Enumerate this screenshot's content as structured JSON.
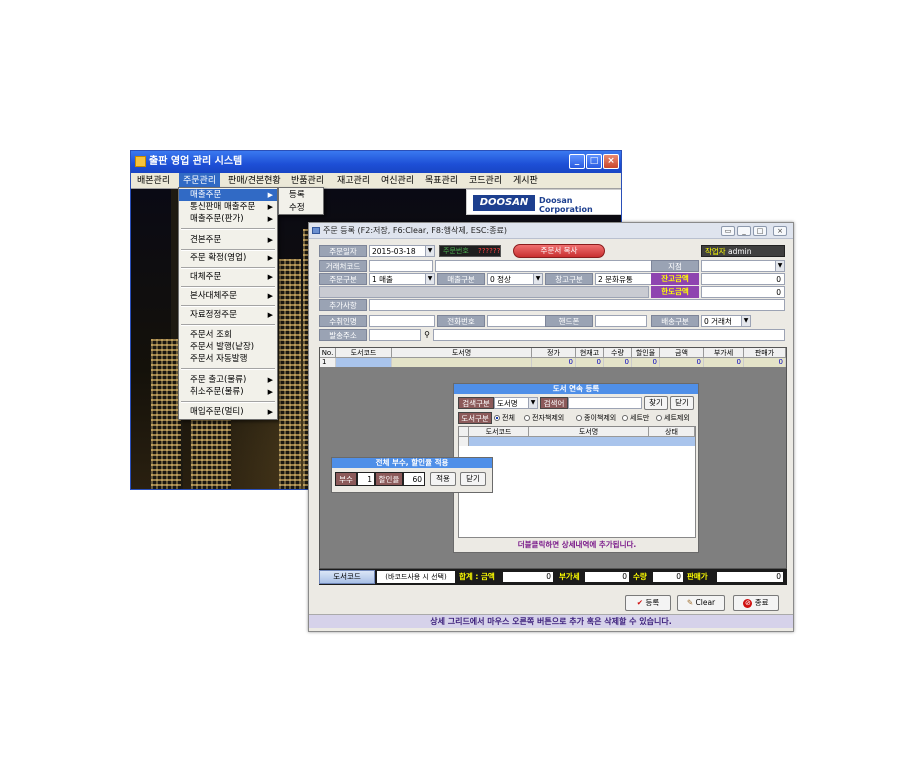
{
  "back_window": {
    "title": "출판 영업 관리 시스템",
    "menubar": [
      "배본관리",
      "주문관리",
      "판매/견본현황",
      "반품관리",
      "재고관리",
      "여신관리",
      "목표관리",
      "코드관리",
      "게시판"
    ],
    "dropdown": [
      {
        "label": "매출주문",
        "arrow": "▶"
      },
      {
        "label": "통신판매 매출주문",
        "arrow": "▶"
      },
      {
        "label": "매출주문(판가)",
        "arrow": "▶"
      },
      {
        "label": "견본주문",
        "arrow": "▶"
      },
      {
        "label": "주문 확정(영업)",
        "arrow": "▶"
      },
      {
        "label": "대체주문",
        "arrow": "▶"
      },
      {
        "label": "본사대체주문",
        "arrow": "▶"
      },
      {
        "label": "자료정정주문",
        "arrow": "▶"
      },
      {
        "label": "주문서 조회",
        "arrow": ""
      },
      {
        "label": "주문서 발행(낱장)",
        "arrow": ""
      },
      {
        "label": "주문서 자동발행",
        "arrow": ""
      },
      {
        "label": "주문 출고(물류)",
        "arrow": "▶"
      },
      {
        "label": "취소주문(물류)",
        "arrow": "▶"
      },
      {
        "label": "매입주문(멀티)",
        "arrow": "▶"
      }
    ],
    "submenu": [
      "등록",
      "수정"
    ],
    "logo_text": "DOOSAN",
    "logo_corp": "Doosan Corporation"
  },
  "front_window": {
    "title": "주문 등록 (F2:저장, F6:Clear, F8:행삭제, ESC:종료)",
    "form": {
      "order_date_label": "주문일자",
      "order_date": "2015-03-18",
      "order_no_label": "주문번호",
      "order_no": "??????",
      "copy_button": "주문서 복사",
      "worker_label": "작업자",
      "worker": "admin",
      "customer_code_label": "거래처코드",
      "branch_label": "지점",
      "order_type_label": "주문구분",
      "order_type": "1 매출",
      "sales_type_label": "매출구분",
      "sales_type": "0 정상",
      "warehouse_type_label": "창고구분",
      "warehouse_type": "2 문화유통",
      "balance_label": "잔고금액",
      "balance": "0",
      "limit_label": "한도금액",
      "limit": "0",
      "note_label": "추가사항",
      "recipient_label": "수취인명",
      "phone_label": "전화번호",
      "mobile_label": "핸드폰",
      "delivery_type_label": "배송구분",
      "delivery_type": "0 거래처",
      "ship_addr_label": "발송주소"
    },
    "grid": {
      "headers": [
        "No.",
        "도서코드",
        "도서명",
        "정가",
        "현재고",
        "수량",
        "할인율",
        "금액",
        "부가세",
        "판매가"
      ],
      "rows": [
        [
          "1",
          "",
          "",
          "0",
          "0",
          "0",
          "0",
          "0",
          "0",
          "0"
        ]
      ]
    },
    "book_dialog": {
      "title": "도서 연속 등록",
      "search_type_label": "검색구분",
      "search_type": "도서명",
      "search_word_label": "검색어",
      "find_button": "찾기",
      "close_button": "닫기",
      "book_type_label": "도서구분",
      "radios": [
        "전체",
        "전자책제외",
        "종이책제외",
        "세트만",
        "세트제외"
      ],
      "grid_headers": [
        "도서코드",
        "도서명",
        "상태"
      ],
      "hint": "더블클릭하면 상세내역에 추가됩니다."
    },
    "qty_dialog": {
      "title": "전체 부수, 할인율 적용",
      "copies_label": "부수",
      "copies": "1",
      "discount_label": "할인율",
      "discount": "60",
      "apply_button": "적용",
      "close_button": "닫기"
    },
    "totals": {
      "book_code_button": "도서코드",
      "barcode_hint": "(바코드사용 시 선택)",
      "sum_label": "합계 : 금액",
      "sum": "0",
      "vat_label": "부가세",
      "vat": "0",
      "qty_label": "수량",
      "qty": "0",
      "price_label": "판매가",
      "price": "0"
    },
    "buttons": {
      "register": "등록",
      "clear": "Clear",
      "exit": "종료"
    },
    "status": "상세 그리드에서 마우스 오른쪽 버튼으로 추가 혹은 삭제할 수 있습니다."
  }
}
